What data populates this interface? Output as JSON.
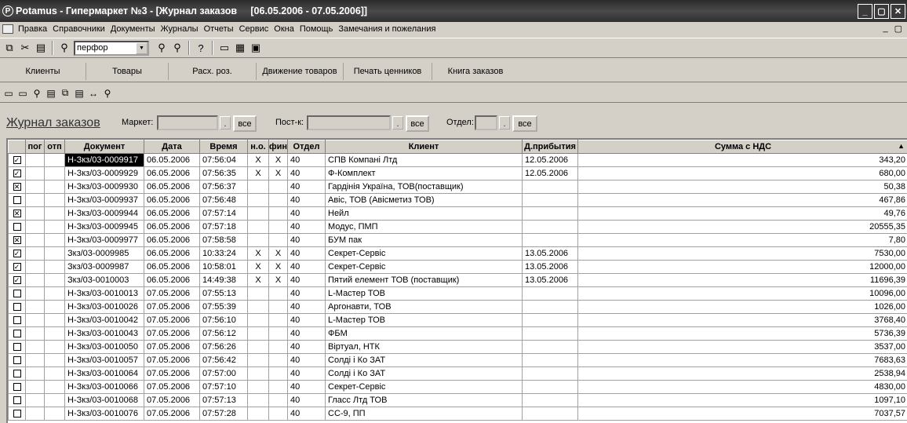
{
  "window": {
    "title": "Potamus - Гипермаркет №3 - [Журнал заказов     [06.05.2006 - 07.05.2006]]",
    "buttons": {
      "minimize": "_",
      "maximize": "▢",
      "close": "✕"
    }
  },
  "menu": {
    "items": [
      "Правка",
      "Справочники",
      "Документы",
      "Журналы",
      "Отчеты",
      "Сервис",
      "Окна",
      "Помощь",
      "Замечания и пожелания"
    ],
    "mdi_minimize": "_",
    "mdi_restore": "▢"
  },
  "toolbar": {
    "search_value": "перфор",
    "help_glyph": "?"
  },
  "nav": {
    "buttons": [
      "Клиенты",
      "Товары",
      "Расх. роз.",
      "Движение товаров",
      "Печать ценников",
      "Книга заказов"
    ]
  },
  "filters": {
    "title": "Журнал заказов",
    "market_label": "Маркет:",
    "supplier_label": "Пост-к:",
    "dept_label": "Отдел:",
    "dots": ".",
    "all_label": "все"
  },
  "grid": {
    "columns": [
      "",
      "пог",
      "отп",
      "Документ",
      "Дата",
      "Время",
      "н.о.",
      "фин",
      "Отдел",
      "Клиент",
      "Д.прибытия",
      "Сумма с НДС"
    ],
    "rows": [
      {
        "check": "✓",
        "doc": "Н-Зкз/03-0009917",
        "date": "06.05.2006",
        "time": "07:56:04",
        "no": "X",
        "fin": "X",
        "dept": "40",
        "client": "СПВ Компані Лтд",
        "arrival": "12.05.2006",
        "sum": "343,20",
        "selected": true
      },
      {
        "check": "✓",
        "doc": "Н-Зкз/03-0009929",
        "date": "06.05.2006",
        "time": "07:56:35",
        "no": "X",
        "fin": "X",
        "dept": "40",
        "client": "Ф-Комплект",
        "arrival": "12.05.2006",
        "sum": "680,00"
      },
      {
        "check": "✕",
        "doc": "Н-Зкз/03-0009930",
        "date": "06.05.2006",
        "time": "07:56:37",
        "no": "",
        "fin": "",
        "dept": "40",
        "client": "Гардінія Україна, ТОВ(поставщик)",
        "arrival": "",
        "sum": "50,38"
      },
      {
        "check": "",
        "doc": "Н-Зкз/03-0009937",
        "date": "06.05.2006",
        "time": "07:56:48",
        "no": "",
        "fin": "",
        "dept": "40",
        "client": "Авіс, ТОВ (Авісметиз ТОВ)",
        "arrival": "",
        "sum": "467,86"
      },
      {
        "check": "✕",
        "doc": "Н-Зкз/03-0009944",
        "date": "06.05.2006",
        "time": "07:57:14",
        "no": "",
        "fin": "",
        "dept": "40",
        "client": "Нейл",
        "arrival": "",
        "sum": "49,76"
      },
      {
        "check": "",
        "doc": "Н-Зкз/03-0009945",
        "date": "06.05.2006",
        "time": "07:57:18",
        "no": "",
        "fin": "",
        "dept": "40",
        "client": "Модус, ПМП",
        "arrival": "",
        "sum": "20555,35"
      },
      {
        "check": "✕",
        "doc": "Н-Зкз/03-0009977",
        "date": "06.05.2006",
        "time": "07:58:58",
        "no": "",
        "fin": "",
        "dept": "40",
        "client": "БУМ пак",
        "arrival": "",
        "sum": "7,80"
      },
      {
        "check": "✓",
        "doc": "Зкз/03-0009985",
        "date": "06.05.2006",
        "time": "10:33:24",
        "no": "X",
        "fin": "X",
        "dept": "40",
        "client": "Секрет-Сервіс",
        "arrival": "13.05.2006",
        "sum": "7530,00"
      },
      {
        "check": "✓",
        "doc": "Зкз/03-0009987",
        "date": "06.05.2006",
        "time": "10:58:01",
        "no": "X",
        "fin": "X",
        "dept": "40",
        "client": "Секрет-Сервіс",
        "arrival": "13.05.2006",
        "sum": "12000,00"
      },
      {
        "check": "✓",
        "doc": "Зкз/03-0010003",
        "date": "06.05.2006",
        "time": "14:49:38",
        "no": "X",
        "fin": "X",
        "dept": "40",
        "client": "Пятий елемент ТОВ (поставщик)",
        "arrival": "13.05.2006",
        "sum": "11696,39"
      },
      {
        "check": "",
        "doc": "Н-Зкз/03-0010013",
        "date": "07.05.2006",
        "time": "07:55:13",
        "no": "",
        "fin": "",
        "dept": "40",
        "client": "L-Мастер ТОВ",
        "arrival": "",
        "sum": "10096,00"
      },
      {
        "check": "",
        "doc": "Н-Зкз/03-0010026",
        "date": "07.05.2006",
        "time": "07:55:39",
        "no": "",
        "fin": "",
        "dept": "40",
        "client": "Аргонавти, ТОВ",
        "arrival": "",
        "sum": "1026,00"
      },
      {
        "check": "",
        "doc": "Н-Зкз/03-0010042",
        "date": "07.05.2006",
        "time": "07:56:10",
        "no": "",
        "fin": "",
        "dept": "40",
        "client": "L-Мастер ТОВ",
        "arrival": "",
        "sum": "3768,40"
      },
      {
        "check": "",
        "doc": "Н-Зкз/03-0010043",
        "date": "07.05.2006",
        "time": "07:56:12",
        "no": "",
        "fin": "",
        "dept": "40",
        "client": "ФБМ",
        "arrival": "",
        "sum": "5736,39"
      },
      {
        "check": "",
        "doc": "Н-Зкз/03-0010050",
        "date": "07.05.2006",
        "time": "07:56:26",
        "no": "",
        "fin": "",
        "dept": "40",
        "client": "Віртуал, НТК",
        "arrival": "",
        "sum": "3537,00"
      },
      {
        "check": "",
        "doc": "Н-Зкз/03-0010057",
        "date": "07.05.2006",
        "time": "07:56:42",
        "no": "",
        "fin": "",
        "dept": "40",
        "client": "Солді і Ко ЗАТ",
        "arrival": "",
        "sum": "7683,63"
      },
      {
        "check": "",
        "doc": "Н-Зкз/03-0010064",
        "date": "07.05.2006",
        "time": "07:57:00",
        "no": "",
        "fin": "",
        "dept": "40",
        "client": "Солді і Ко ЗАТ",
        "arrival": "",
        "sum": "2538,94"
      },
      {
        "check": "",
        "doc": "Н-Зкз/03-0010066",
        "date": "07.05.2006",
        "time": "07:57:10",
        "no": "",
        "fin": "",
        "dept": "40",
        "client": "Секрет-Сервіс",
        "arrival": "",
        "sum": "4830,00"
      },
      {
        "check": "",
        "doc": "Н-Зкз/03-0010068",
        "date": "07.05.2006",
        "time": "07:57:13",
        "no": "",
        "fin": "",
        "dept": "40",
        "client": "Гласс Лтд ТОВ",
        "arrival": "",
        "sum": "1097,10"
      },
      {
        "check": "",
        "doc": "Н-Зкз/03-0010076",
        "date": "07.05.2006",
        "time": "07:57:28",
        "no": "",
        "fin": "",
        "dept": "40",
        "client": "СС-9, ПП",
        "arrival": "",
        "sum": "7037,57"
      }
    ]
  }
}
